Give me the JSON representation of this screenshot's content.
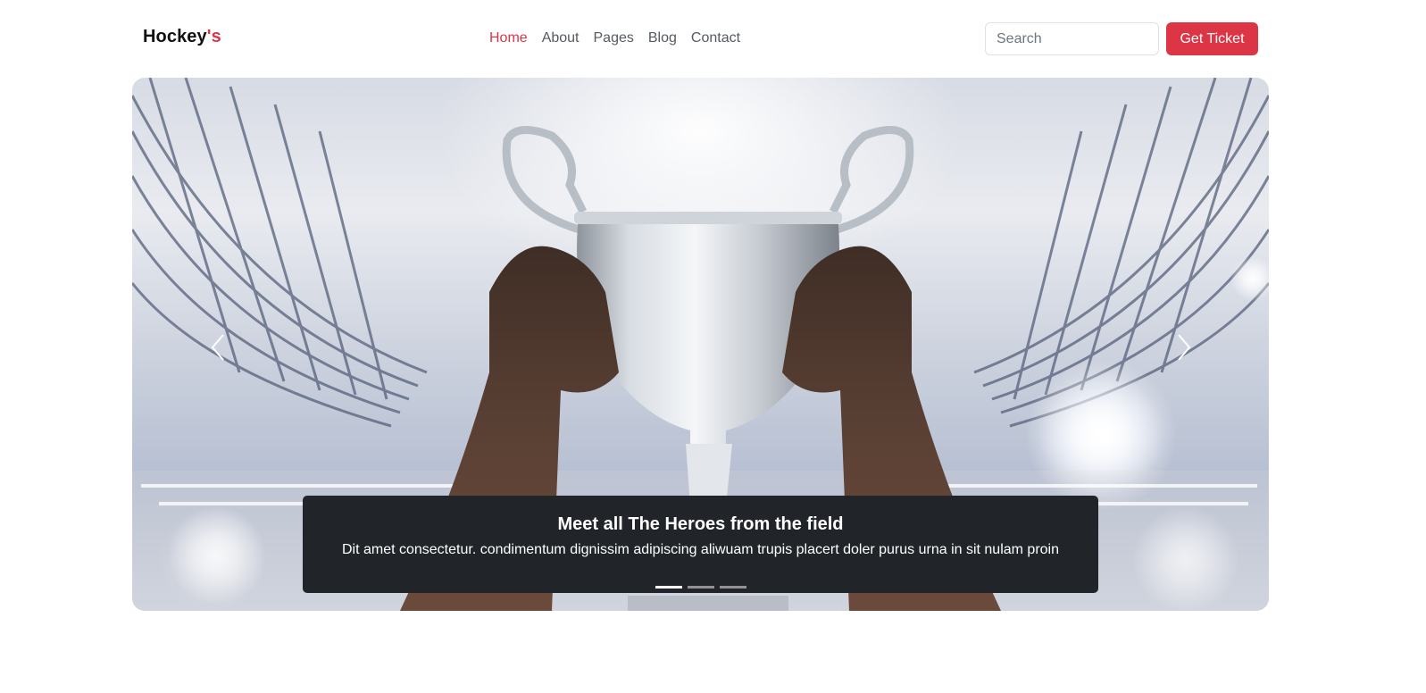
{
  "navbar": {
    "brand": {
      "main": "Hockey",
      "accent": "'s"
    },
    "links": [
      {
        "label": "Home",
        "active": true
      },
      {
        "label": "About",
        "active": false
      },
      {
        "label": "Pages",
        "active": false
      },
      {
        "label": "Blog",
        "active": false
      },
      {
        "label": "Contact",
        "active": false
      }
    ],
    "search": {
      "placeholder": "Search",
      "value": ""
    },
    "ticket_label": "Get Ticket"
  },
  "carousel": {
    "slide_count": 3,
    "active_slide": 0,
    "caption": {
      "title": "Meet all The Heroes from the field",
      "text": "Dit amet consectetur. condimentum dignissim adipiscing aliwuam trupis placert doler purus urna in sit nulam proin"
    },
    "icons": {
      "prev": "chevron-left-icon",
      "next": "chevron-right-icon"
    }
  },
  "colors": {
    "accent": "#dc3545",
    "caption_bg": "#212529",
    "nav_text": "#555b61"
  }
}
